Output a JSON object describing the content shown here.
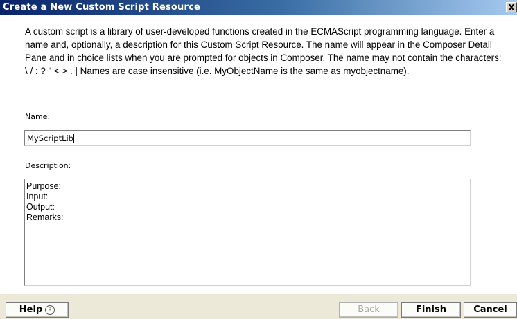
{
  "window": {
    "title": "Create a New Custom Script Resource",
    "close_label": "X"
  },
  "intro": {
    "text": "A custom script is a library of user-developed functions created in the ECMAScript programming language. Enter a name and, optionally, a description for this Custom Script Resource.  The name will appear in the Composer Detail Pane and in choice lists when you are prompted for objects in Composer.  The name may not contain the characters: \\ / : ? \" < > . |  Names are case insensitive (i.e. MyObjectName is the same as myobjectname)."
  },
  "form": {
    "name_label": "Name:",
    "name_value": "MyScriptLib",
    "description_label": "Description:",
    "description_lines": [
      "Purpose:",
      "Input:",
      "Output:",
      "Remarks:"
    ]
  },
  "buttons": {
    "help": "Help",
    "help_icon": "?",
    "back": "Back",
    "finish": "Finish",
    "cancel": "Cancel"
  }
}
